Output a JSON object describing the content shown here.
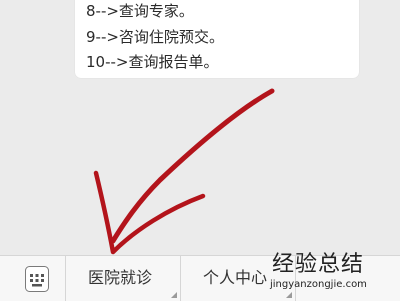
{
  "chat": {
    "lines": [
      "8-->查询专家。",
      "9-->咨询住院预交。",
      "10-->查询报告单。"
    ]
  },
  "bottom_menu": {
    "keyboard_icon": "keyboard-icon",
    "items": [
      {
        "label": "医院就诊"
      },
      {
        "label": "个人中心"
      }
    ]
  },
  "overlay": {
    "arrow_color": "#b3141b",
    "arrow_icon": "red-arrow-annotation"
  },
  "watermark": {
    "main_text": "经验总结",
    "sub_text": "jingyanzongjie.com"
  }
}
